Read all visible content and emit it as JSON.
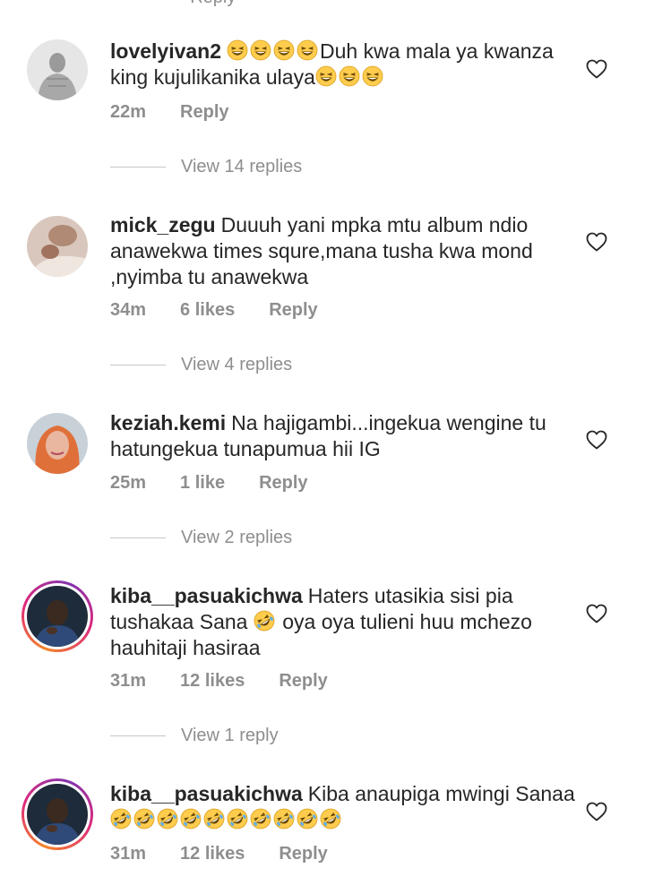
{
  "top_partial": "· Reply",
  "comments": [
    {
      "username": "lovelyivan2",
      "text": "Duh kwa mala ya kwanza king kujulikanika ulaya",
      "lead_emojis": 4,
      "trail_emojis": 3,
      "emoji_name": "grinning-squinting-face-icon",
      "time": "22m",
      "likes": "",
      "reply": "Reply",
      "view_replies": "View 14 replies"
    },
    {
      "username": "mick_zegu",
      "text": "Duuuh yani mpka mtu album ndio anawekwa times squre,mana tusha kwa mond ,nyimba tu anawekwa",
      "time": "34m",
      "likes": "6 likes",
      "reply": "Reply",
      "view_replies": "View 4 replies"
    },
    {
      "username": "keziah.kemi",
      "text": "Na hajigambi...ingekua wengine tu hatungekua tunapumua hii IG",
      "time": "25m",
      "likes": "1 like",
      "reply": "Reply",
      "view_replies": "View 2 replies"
    },
    {
      "username": "kiba__pasuakichwa",
      "text_before": "Haters utasikia sisi pia tushakaa Sana",
      "text_after": "oya oya tulieni huu mchezo hauhitaji hasiraa",
      "emoji_name": "rolling-laughing-face-icon",
      "time": "31m",
      "likes": "12 likes",
      "reply": "Reply",
      "view_replies": "View 1 reply"
    },
    {
      "username": "kiba__pasuakichwa",
      "text": "Kiba anaupiga mwingi Sanaa",
      "trail_emojis": 10,
      "emoji_name": "rolling-laughing-face-icon",
      "time": "31m",
      "likes": "12 likes",
      "reply": "Reply"
    }
  ],
  "colors": {
    "text": "#262626",
    "muted": "#8e8e8e",
    "story_ring_start": "#f58529",
    "story_ring_end": "#dd2a7b",
    "emoji_face": "#ffcc4d"
  }
}
